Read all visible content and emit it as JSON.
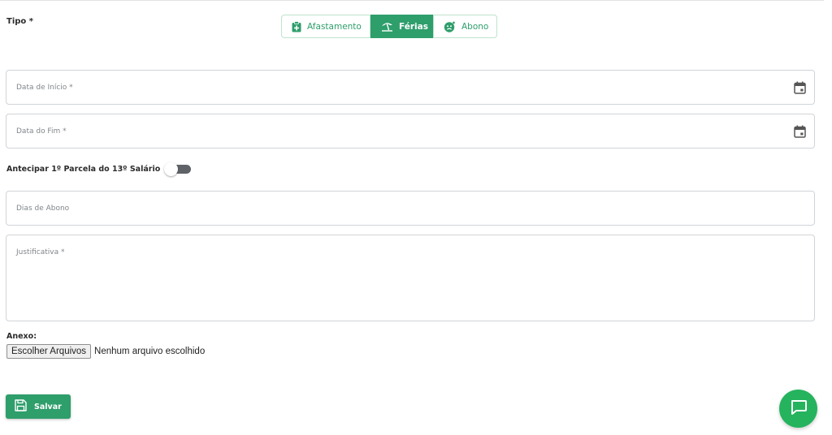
{
  "form": {
    "tipo_label": "Tipo *",
    "tipo_options": [
      {
        "label": "Afastamento",
        "icon": "medical-clipboard-icon",
        "selected": false
      },
      {
        "label": "Férias",
        "icon": "beach-umbrella-icon",
        "selected": true
      },
      {
        "label": "Abono",
        "icon": "mood-icon",
        "selected": false
      }
    ],
    "data_inicio_placeholder": "Data de Início *",
    "data_fim_placeholder": "Data do Fim *",
    "antecipar_label": "Antecipar 1º Parcela do 13º Salário",
    "antecipar_on": false,
    "dias_abono_placeholder": "Dias de Abono",
    "justificativa_placeholder": "Justificativa *",
    "anexo_label": "Anexo:",
    "file_button_label": "Escolher Arquivos",
    "file_status": "Nenhum arquivo escolhido",
    "save_label": "Salvar"
  },
  "colors": {
    "accent": "#2e9e6b",
    "accent_border": "#bfe3cf",
    "chat_fab": "#25b35e",
    "toggle_off": "#5f6368"
  }
}
